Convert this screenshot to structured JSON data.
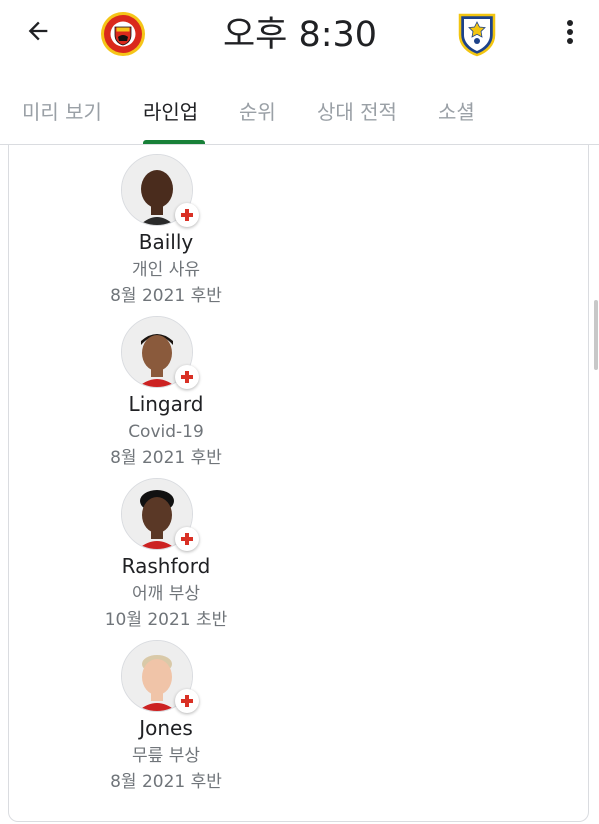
{
  "header": {
    "match_time": "오후 8:30",
    "home_crest_icon": "manchester-united-crest-icon",
    "away_crest_icon": "leeds-united-crest-icon",
    "back_icon": "back-arrow-icon",
    "more_icon": "more-vert-icon"
  },
  "tabs": [
    {
      "label": "미리 보기",
      "active": false
    },
    {
      "label": "라인업",
      "active": true
    },
    {
      "label": "순위",
      "active": false
    },
    {
      "label": "상대 전적",
      "active": false
    },
    {
      "label": "소셜",
      "active": false
    }
  ],
  "colors": {
    "tab_indicator": "#188038",
    "injury_cross": "#d93025",
    "muted_text": "#70757a"
  },
  "players": [
    {
      "name": "Bailly",
      "reason": "개인 사유",
      "return": "8월 2021 후반"
    },
    {
      "name": "Lingard",
      "reason": "Covid-19",
      "return": "8월 2021 후반"
    },
    {
      "name": "Rashford",
      "reason": "어깨 부상",
      "return": "10월 2021 초반"
    },
    {
      "name": "Jones",
      "reason": "무릎 부상",
      "return": "8월 2021 후반"
    }
  ]
}
